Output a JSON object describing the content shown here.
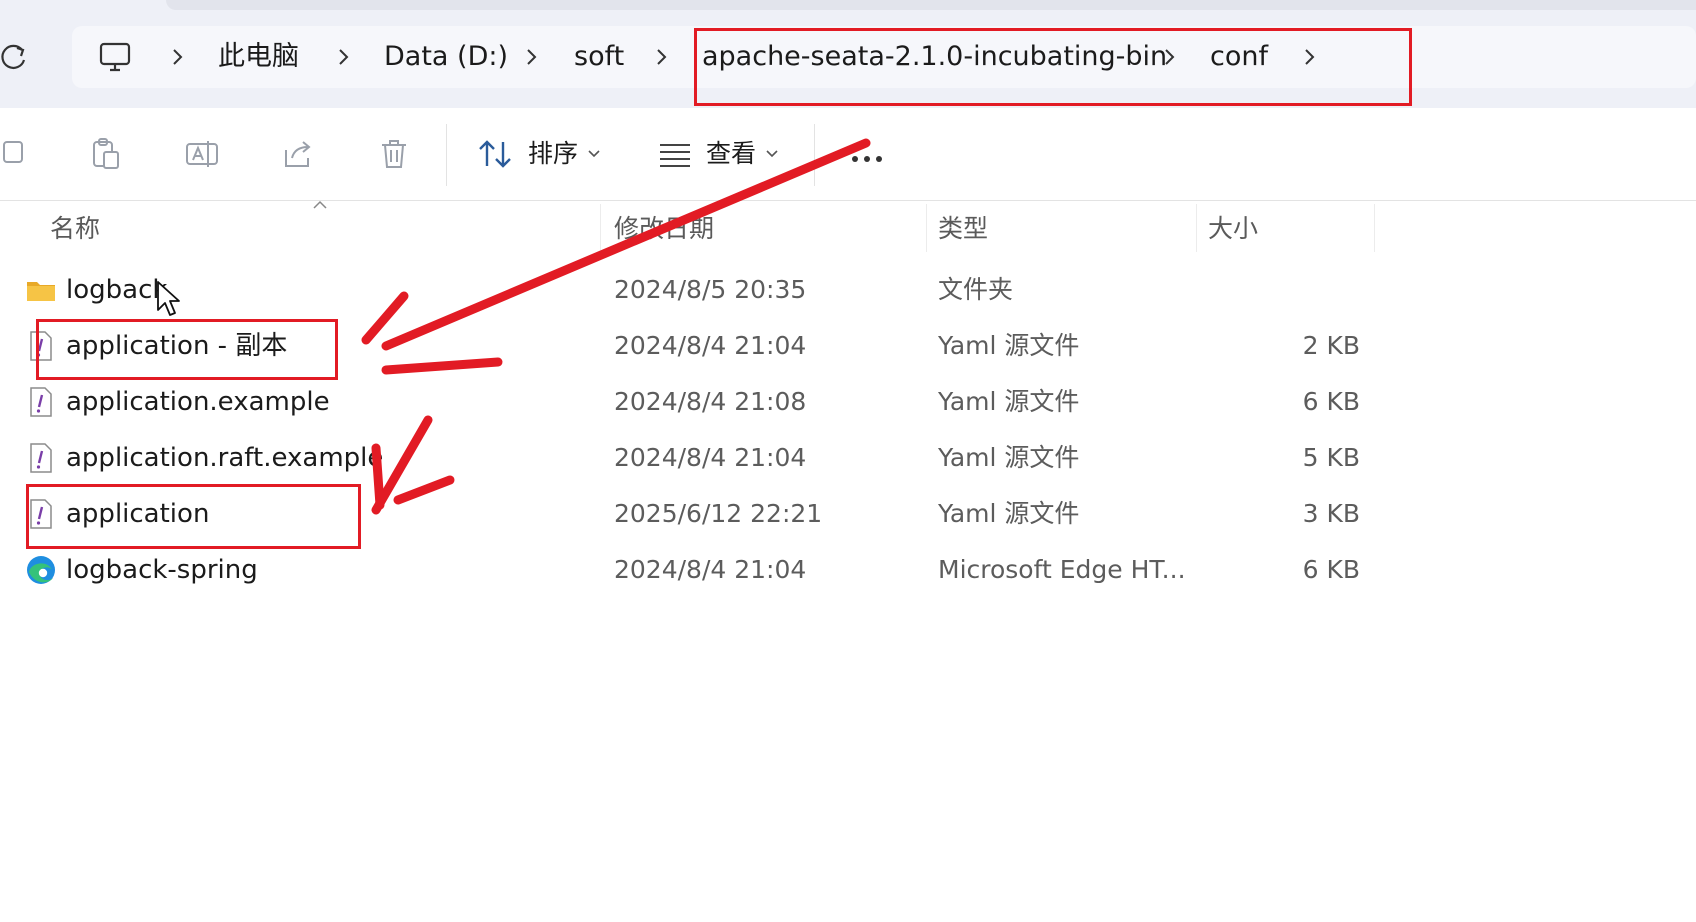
{
  "breadcrumb": {
    "items": [
      "此电脑",
      "Data (D:)",
      "soft",
      "apache-seata-2.1.0-incubating-bin",
      "conf"
    ]
  },
  "toolbar": {
    "sort_label": "排序",
    "view_label": "查看"
  },
  "columns": {
    "name": "名称",
    "modified": "修改日期",
    "type": "类型",
    "size": "大小"
  },
  "files": [
    {
      "name": "logback",
      "modified": "2024/8/5 20:35",
      "type": "文件夹",
      "size": "",
      "icon": "folder-icon"
    },
    {
      "name": "application - 副本",
      "modified": "2024/8/4 21:04",
      "type": "Yaml 源文件",
      "size": "2 KB",
      "icon": "yaml-file-icon"
    },
    {
      "name": "application.example",
      "modified": "2024/8/4 21:08",
      "type": "Yaml 源文件",
      "size": "6 KB",
      "icon": "yaml-file-icon"
    },
    {
      "name": "application.raft.example",
      "modified": "2024/8/4 21:04",
      "type": "Yaml 源文件",
      "size": "5 KB",
      "icon": "yaml-file-icon"
    },
    {
      "name": "application",
      "modified": "2025/6/12 22:21",
      "type": "Yaml 源文件",
      "size": "3 KB",
      "icon": "yaml-file-icon"
    },
    {
      "name": "logback-spring",
      "modified": "2024/8/4 21:04",
      "type": "Microsoft Edge HT...",
      "size": "6 KB",
      "icon": "edge-html-icon"
    }
  ],
  "colors": {
    "annotation_red": "#e21b24",
    "folder_yellow": "#f6c445",
    "yaml_purple": "#7a3ea8"
  }
}
